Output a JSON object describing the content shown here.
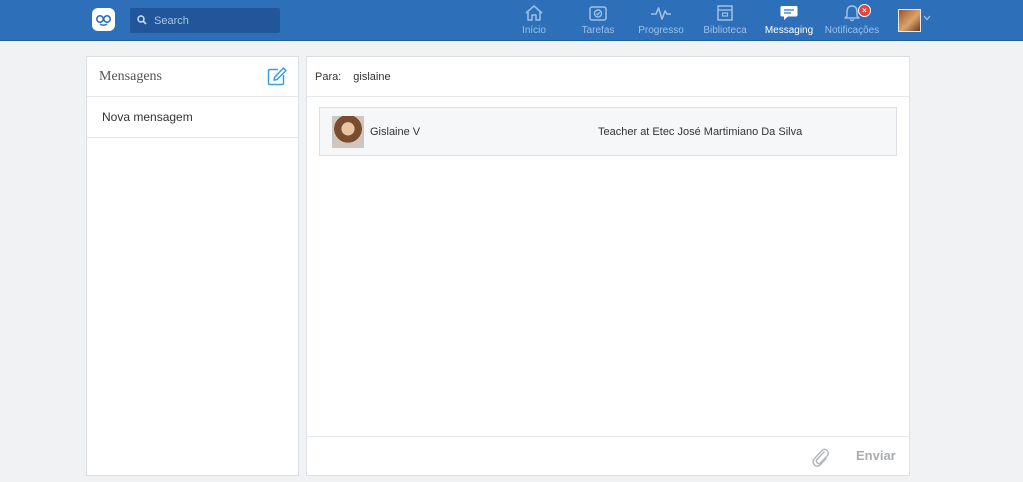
{
  "header": {
    "search_placeholder": "Search",
    "nav": [
      {
        "label": "Início",
        "icon": "home-icon"
      },
      {
        "label": "Tarefas",
        "icon": "assignments-icon"
      },
      {
        "label": "Progresso",
        "icon": "progress-icon"
      },
      {
        "label": "Biblioteca",
        "icon": "library-icon"
      },
      {
        "label": "Messaging",
        "icon": "messaging-icon",
        "active": true
      },
      {
        "label": "Notificações",
        "icon": "notifications-icon",
        "badge": "×"
      }
    ]
  },
  "sidebar": {
    "title": "Mensagens",
    "items": [
      {
        "label": "Nova mensagem"
      }
    ]
  },
  "compose": {
    "to_label": "Para:",
    "to_value": "gislaine",
    "suggestions": [
      {
        "name": "Gislaine V",
        "role": "Teacher at Etec José Martimiano Da Silva"
      }
    ],
    "send_label": "Enviar"
  },
  "colors": {
    "header_bg": "#2d6fb8",
    "accent": "#3aa0d8",
    "badge": "#e8433b"
  }
}
